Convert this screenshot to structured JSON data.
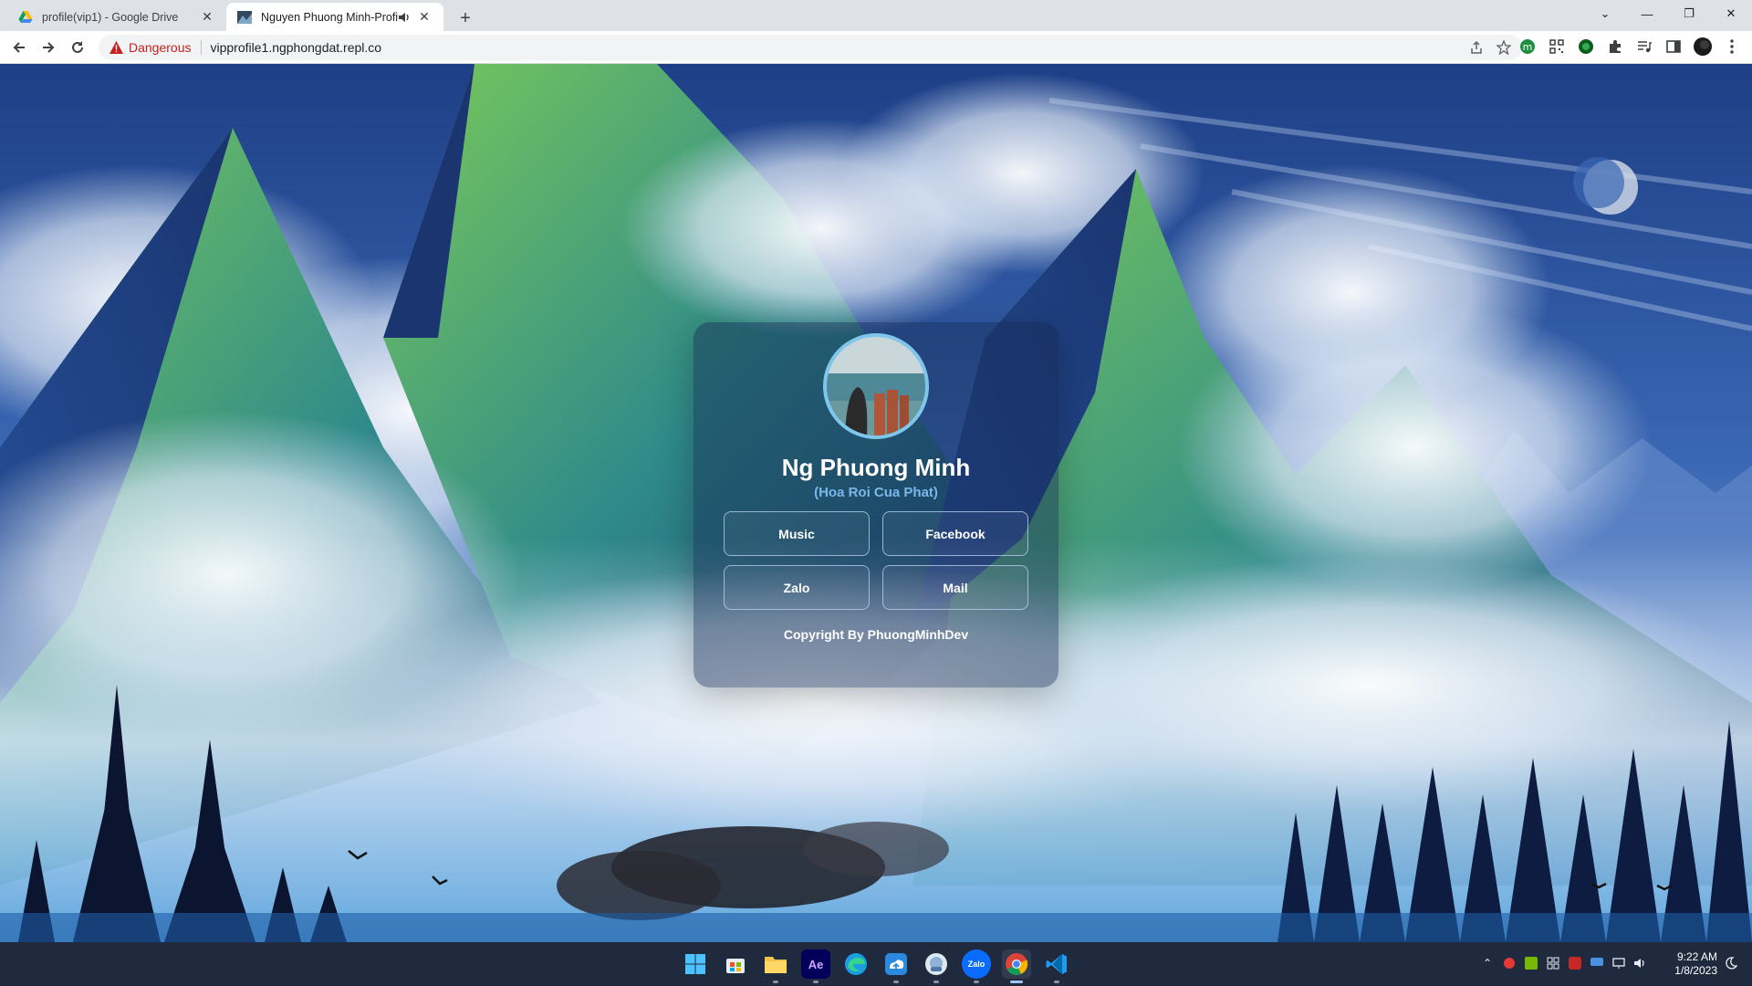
{
  "browser": {
    "tabs": [
      {
        "title": "profile(vip1) - Google Drive",
        "active": false,
        "icon": "google-drive-icon"
      },
      {
        "title": "Nguyen Phuong Minh-Profile",
        "active": true,
        "icon": "page-thumbnail-icon",
        "audio": "speaker-icon"
      }
    ],
    "omnibox": {
      "security_label": "Dangerous",
      "url": "vipprofile1.ngphongdat.repl.co"
    },
    "colors": {
      "danger": "#c5221f",
      "tabstrip": "#dee1e6"
    }
  },
  "profile": {
    "name": "Ng Phuong Minh",
    "subtitle": "(Hoa Roi Cua Phat)",
    "buttons": {
      "music": "Music",
      "facebook": "Facebook",
      "zalo": "Zalo",
      "mail": "Mail"
    },
    "copyright": "Copyright By PhuongMinhDev",
    "colors": {
      "subtitle": "#7ab8ea",
      "avatar_border": "#7fc6ec"
    }
  },
  "taskbar": {
    "apps": [
      "start-icon",
      "store-icon",
      "file-explorer-icon",
      "after-effects-icon",
      "edge-icon",
      "cloud-app-icon",
      "finder-like-icon",
      "zalo-icon",
      "chrome-icon",
      "vscode-icon"
    ],
    "zalo_label": "Zalo",
    "ae_label": "Ae",
    "clock": {
      "time": "9:22 AM",
      "date": "1/8/2023"
    }
  }
}
